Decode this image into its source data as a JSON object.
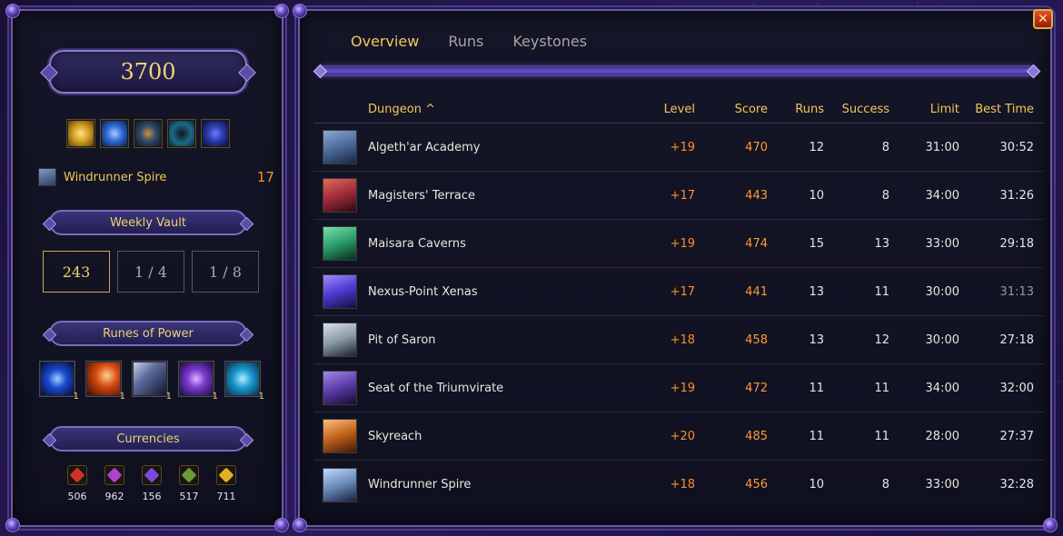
{
  "overall_score": "3700",
  "affixes": [
    {
      "icon": "golden-orb-icon",
      "color": "#d4a020"
    },
    {
      "icon": "blue-swirl-icon",
      "color": "#2a6ad4"
    },
    {
      "icon": "dark-eye-icon",
      "color": "#2f4a6a"
    },
    {
      "icon": "shadow-figure-icon",
      "color": "#1c6a8a"
    },
    {
      "icon": "arcane-runes-icon",
      "color": "#2a3aa8"
    }
  ],
  "last_run": {
    "dungeon": "Windrunner Spire",
    "level": "17"
  },
  "weekly_vault": {
    "label": "Weekly Vault",
    "slots": [
      "243",
      "1 / 4",
      "1 / 8"
    ]
  },
  "runes_of_power": {
    "label": "Runes of Power",
    "items": [
      {
        "icon": "blue-orb-rune-icon",
        "count": "1",
        "color": "#1a4ad0"
      },
      {
        "icon": "fire-swirl-rune-icon",
        "count": "1",
        "color": "#d44a10"
      },
      {
        "icon": "sword-rune-icon",
        "count": "1",
        "color": "#5a6a9a"
      },
      {
        "icon": "violet-figure-rune-icon",
        "count": "1",
        "color": "#7a3ad0"
      },
      {
        "icon": "frost-figure-rune-icon",
        "count": "1",
        "color": "#1a9ad0"
      }
    ]
  },
  "currencies": {
    "label": "Currencies",
    "items": [
      {
        "icon": "red-crest-icon",
        "value": "506",
        "color": "#d0302a"
      },
      {
        "icon": "purple-crest-icon",
        "value": "962",
        "color": "#b040d0"
      },
      {
        "icon": "violet-crest-icon",
        "value": "156",
        "color": "#7a4ad8"
      },
      {
        "icon": "green-crest-icon",
        "value": "517",
        "color": "#6a9a3a"
      },
      {
        "icon": "gold-crest-icon",
        "value": "711",
        "color": "#e0b020"
      }
    ]
  },
  "tabs": [
    {
      "label": "Overview",
      "active": true
    },
    {
      "label": "Runs",
      "active": false
    },
    {
      "label": "Keystones",
      "active": false
    }
  ],
  "table": {
    "headers": {
      "dungeon": "Dungeon ^",
      "level": "Level",
      "score": "Score",
      "runs": "Runs",
      "success": "Success",
      "limit": "Limit",
      "best": "Best Time"
    },
    "rows": [
      {
        "dungeon": "Algeth'ar Academy",
        "level": "+19",
        "score": "470",
        "runs": "12",
        "success": "8",
        "limit": "31:00",
        "best": "30:52",
        "color": "#4a6a9a"
      },
      {
        "dungeon": "Magisters' Terrace",
        "level": "+17",
        "score": "443",
        "runs": "10",
        "success": "8",
        "limit": "34:00",
        "best": "31:26",
        "color": "#a02a3a"
      },
      {
        "dungeon": "Maisara Caverns",
        "level": "+19",
        "score": "474",
        "runs": "15",
        "success": "13",
        "limit": "33:00",
        "best": "29:18",
        "color": "#2a9a6a"
      },
      {
        "dungeon": "Nexus-Point Xenas",
        "level": "+17",
        "score": "441",
        "runs": "13",
        "success": "11",
        "limit": "30:00",
        "best": "31:13",
        "color": "#4a3ad0"
      },
      {
        "dungeon": "Pit of Saron",
        "level": "+18",
        "score": "458",
        "runs": "13",
        "success": "12",
        "limit": "30:00",
        "best": "27:18",
        "color": "#8a9aa8"
      },
      {
        "dungeon": "Seat of the Triumvirate",
        "level": "+19",
        "score": "472",
        "runs": "11",
        "success": "11",
        "limit": "34:00",
        "best": "32:00",
        "color": "#5a3aa8"
      },
      {
        "dungeon": "Skyreach",
        "level": "+20",
        "score": "485",
        "runs": "11",
        "success": "11",
        "limit": "28:00",
        "best": "27:37",
        "color": "#c0601a"
      },
      {
        "dungeon": "Windrunner Spire",
        "level": "+18",
        "score": "456",
        "runs": "10",
        "success": "8",
        "limit": "33:00",
        "best": "32:28",
        "color": "#6a8ab8"
      }
    ]
  },
  "close_glyph": "✕"
}
